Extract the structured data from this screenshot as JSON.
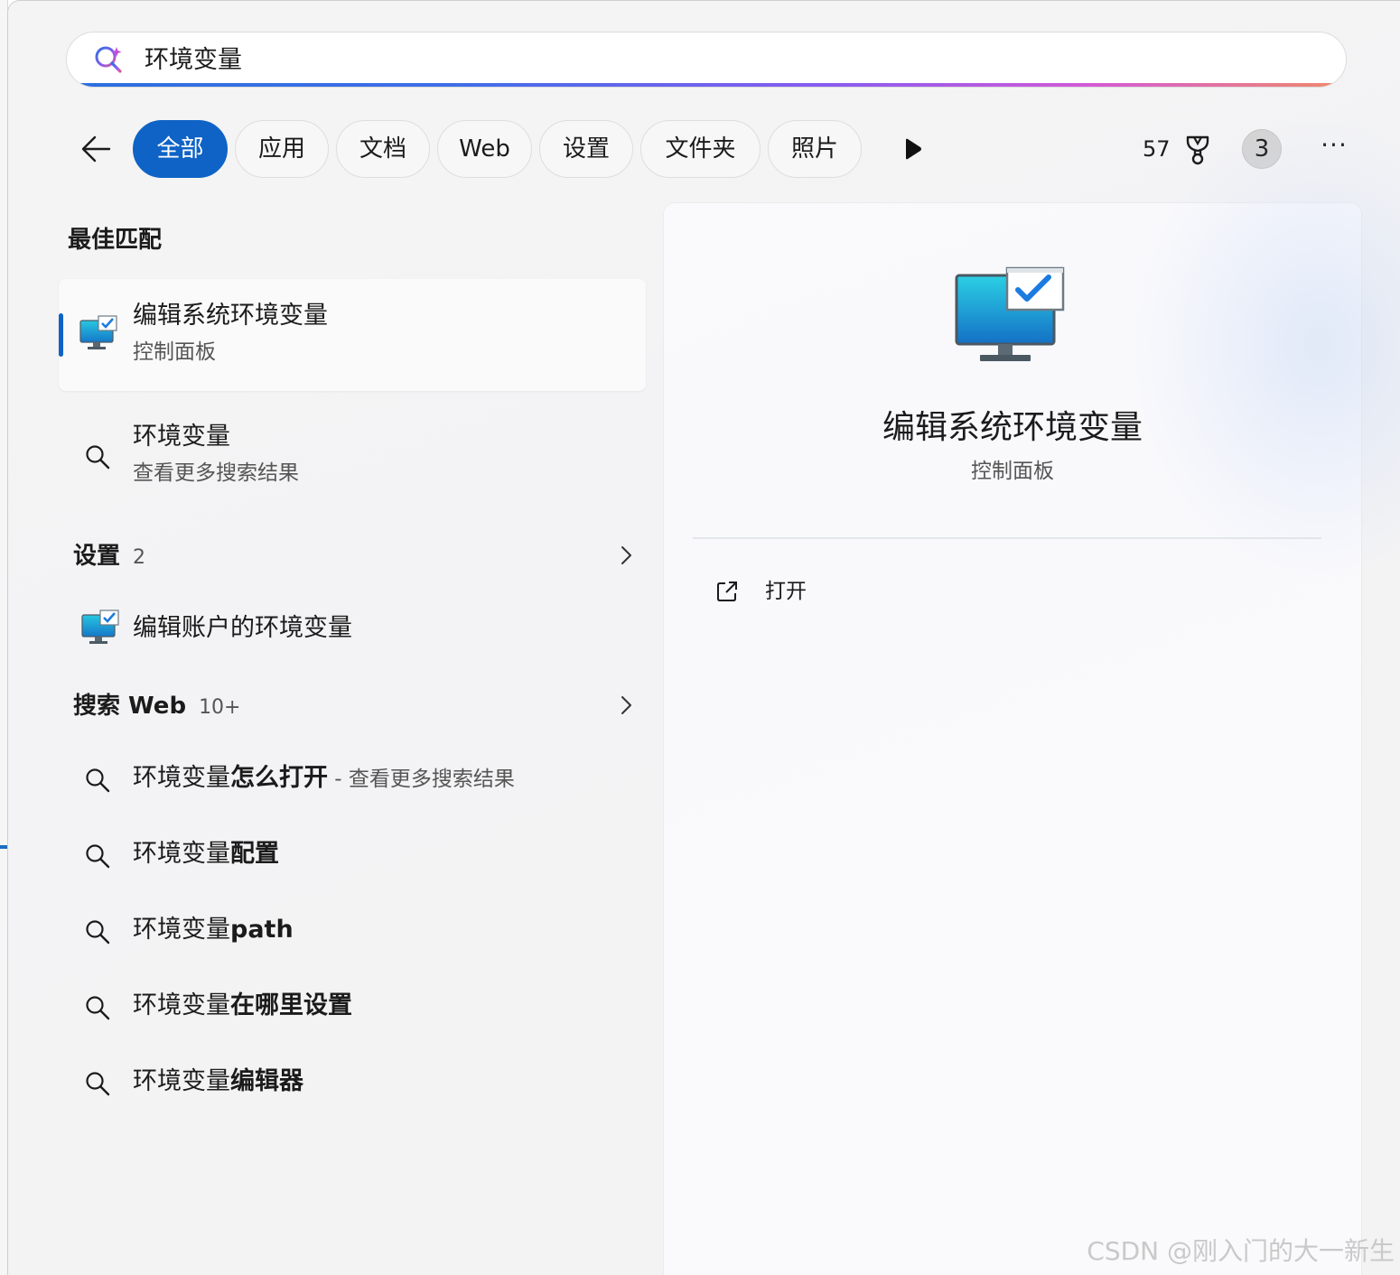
{
  "search": {
    "query": "环境变量"
  },
  "filters": {
    "items": [
      {
        "label": "全部",
        "active": true
      },
      {
        "label": "应用"
      },
      {
        "label": "文档"
      },
      {
        "label": "Web"
      },
      {
        "label": "设置"
      },
      {
        "label": "文件夹"
      },
      {
        "label": "照片"
      }
    ]
  },
  "toolbar": {
    "points": "57",
    "avatar_letter": "3",
    "more_label": "···"
  },
  "best_match": {
    "heading": "最佳匹配",
    "title": "编辑系统环境变量",
    "subtitle": "控制面板"
  },
  "search_more": {
    "title": "环境变量",
    "subtitle": "查看更多搜索结果"
  },
  "settings_section": {
    "heading": "设置",
    "count": "2",
    "items": [
      {
        "label": "编辑账户的环境变量"
      }
    ]
  },
  "web_section": {
    "heading": "搜索 Web",
    "count": "10+",
    "items": [
      {
        "prefix": "环境变量",
        "bold": "怎么打开",
        "hint": " - 查看更多搜索结果"
      },
      {
        "prefix": "环境变量",
        "bold": "配置"
      },
      {
        "prefix": "环境变量",
        "bold": "path"
      },
      {
        "prefix": "环境变量",
        "bold": "在哪里设置"
      },
      {
        "prefix": "环境变量",
        "bold": "编辑器"
      }
    ]
  },
  "detail": {
    "title": "编辑系统环境变量",
    "subtitle": "控制面板",
    "actions": [
      {
        "label": "打开",
        "icon": "open-external-icon"
      }
    ]
  },
  "watermark": "CSDN @刚入门的大一新生",
  "colors": {
    "accent": "#0f63c6",
    "panel": "#f3f3f3"
  }
}
